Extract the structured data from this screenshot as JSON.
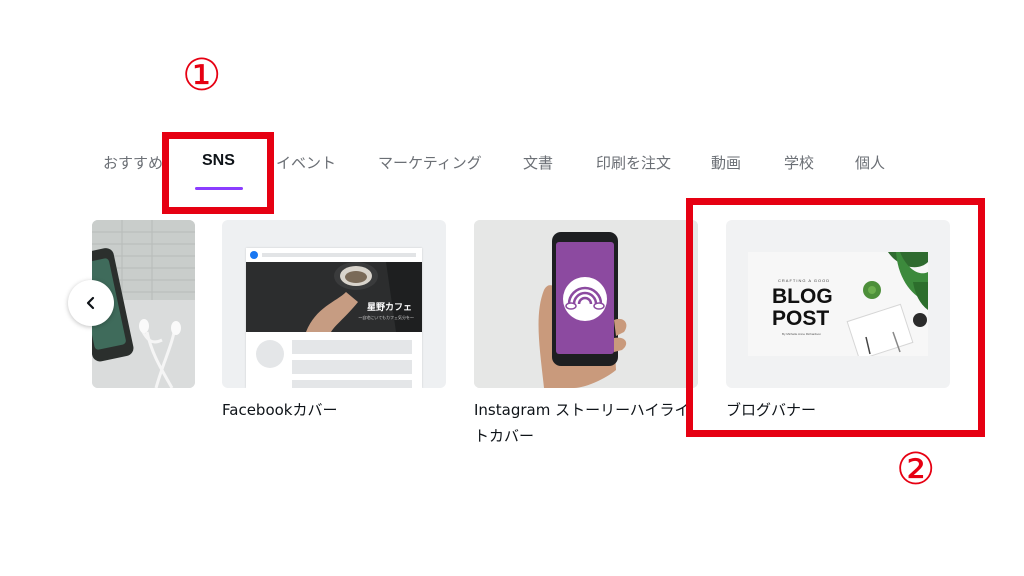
{
  "annotations": {
    "marker1": "①",
    "marker2": "②"
  },
  "tabs": [
    {
      "label": "おすすめ"
    },
    {
      "label": "SNS"
    },
    {
      "label": "イベント"
    },
    {
      "label": "マーケティング"
    },
    {
      "label": "文書"
    },
    {
      "label": "印刷を注文"
    },
    {
      "label": "動画"
    },
    {
      "label": "学校"
    },
    {
      "label": "個人"
    }
  ],
  "cards": [
    {
      "label": ""
    },
    {
      "label": "Facebookカバー",
      "preview_text": "星野カフェ",
      "preview_subtext": "〜自宅にいてもカフェ気分を〜"
    },
    {
      "label_line1": "Instagram ストーリーハイライ",
      "label_line2": "トカバー"
    },
    {
      "label": "ブログバナー",
      "preview_kicker": "CRAFTING A GOOD",
      "preview_title1": "BLOG",
      "preview_title2": "POST",
      "preview_byline": "By Michelle Anne Richardson"
    }
  ],
  "colors": {
    "accent": "#8b3dff",
    "annotation_red": "#e60012"
  },
  "icons": {
    "prev": "chevron-left-icon",
    "facebook": "facebook-icon",
    "rainbow": "rainbow-icon"
  }
}
